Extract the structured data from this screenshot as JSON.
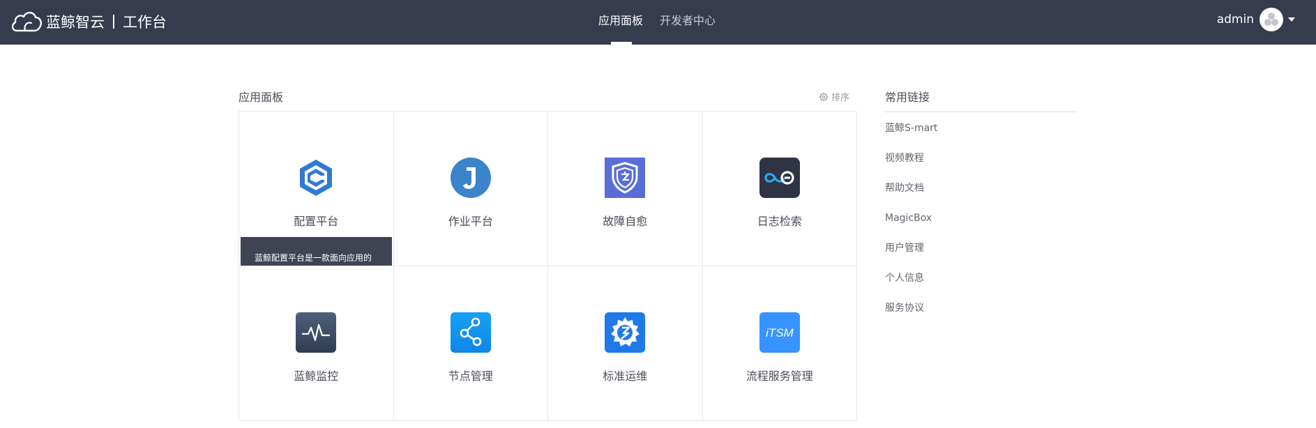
{
  "header": {
    "brand_name": "蓝鲸智云",
    "brand_sub": "工作台",
    "nav": [
      {
        "label": "应用面板",
        "active": true
      },
      {
        "label": "开发者中心",
        "active": false
      }
    ],
    "user_name": "admin"
  },
  "panel": {
    "title": "应用面板",
    "sort_label": "排序",
    "apps": [
      {
        "label": "配置平台",
        "icon": "cmdb-hexagon-c-icon",
        "tooltip": "蓝鲸配置平台是一款面向应用的"
      },
      {
        "label": "作业平台",
        "icon": "job-j-icon"
      },
      {
        "label": "故障自愈",
        "icon": "fta-shield-icon"
      },
      {
        "label": "日志检索",
        "icon": "log-search-infinity-icon"
      },
      {
        "label": "蓝鲸监控",
        "icon": "monitor-pulse-icon"
      },
      {
        "label": "节点管理",
        "icon": "node-man-graph-icon"
      },
      {
        "label": "标准运维",
        "icon": "sops-gear-icon"
      },
      {
        "label": "流程服务管理",
        "icon": "itsm-icon",
        "icon_text": "iTSM"
      }
    ]
  },
  "links": {
    "title": "常用链接",
    "items": [
      "蓝鲸S-mart",
      "视频教程",
      "帮助文档",
      "MagicBox",
      "用户管理",
      "个人信息",
      "服务协议"
    ]
  },
  "colors": {
    "header_bg": "#363b4e",
    "tooltip_bg": "#3e4454",
    "accent_blue": "#3a84ff"
  }
}
